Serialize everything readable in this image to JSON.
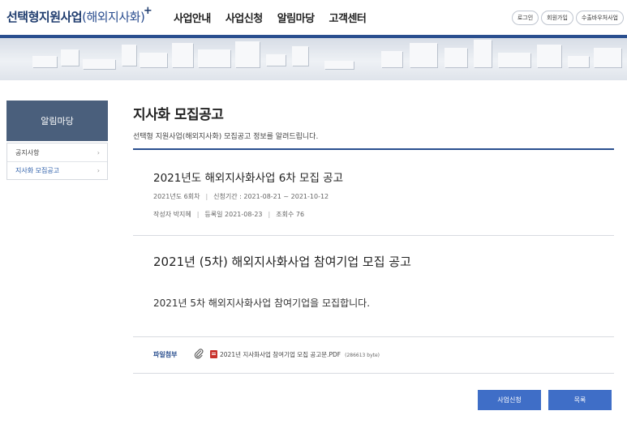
{
  "header": {
    "logo_main": "선택형지원사업",
    "logo_sub": "(해외지사화)",
    "logo_plus": "+",
    "nav": [
      "사업안내",
      "사업신청",
      "알림마당",
      "고객센터"
    ],
    "util": [
      "로그인",
      "회원가입",
      "수출바우처사업"
    ]
  },
  "sidebar": {
    "title": "알림마당",
    "items": [
      {
        "label": "공지사항",
        "arrow": "›"
      },
      {
        "label": "지사화 모집공고",
        "arrow": "›"
      }
    ]
  },
  "content": {
    "title": "지사화 모집공고",
    "description": "선택형 지원사업(해외지사화) 모집공고 정보를 알려드립니다.",
    "post1": {
      "title": "2021년도 해외지사화사업 6차 모집 공고",
      "round": "2021년도 6회차",
      "period": "신청기간 : 2021-08-21 ~ 2021-10-12",
      "author": "작성자 박지혜",
      "date": "등록일 2021-08-23",
      "views": "조회수 76",
      "sep": "|"
    },
    "post2": {
      "title": "2021년 (5차) 해외지사화사업 참여기업 모집 공고",
      "body": "2021년 5차 해외지사화사업 참여기업을 모집합니다."
    },
    "attachment": {
      "label": "파일첨부",
      "filename": "2021년 지사화사업 참여기업 모집 공고문.PDF",
      "size": "(286613 byte)"
    }
  },
  "buttons": {
    "apply": "사업신청",
    "list": "목록"
  },
  "colors": {
    "brand_navy": "#1f3c6e",
    "accent_bar": "#2a4f8f",
    "sidebar_title_bg": "#4a5f7c",
    "button_blue": "#3f6ec7"
  },
  "icons": {
    "attachment": "paperclip-icon",
    "file": "pdf-file-icon",
    "sidebar_arrow": "chevron-right-icon"
  }
}
